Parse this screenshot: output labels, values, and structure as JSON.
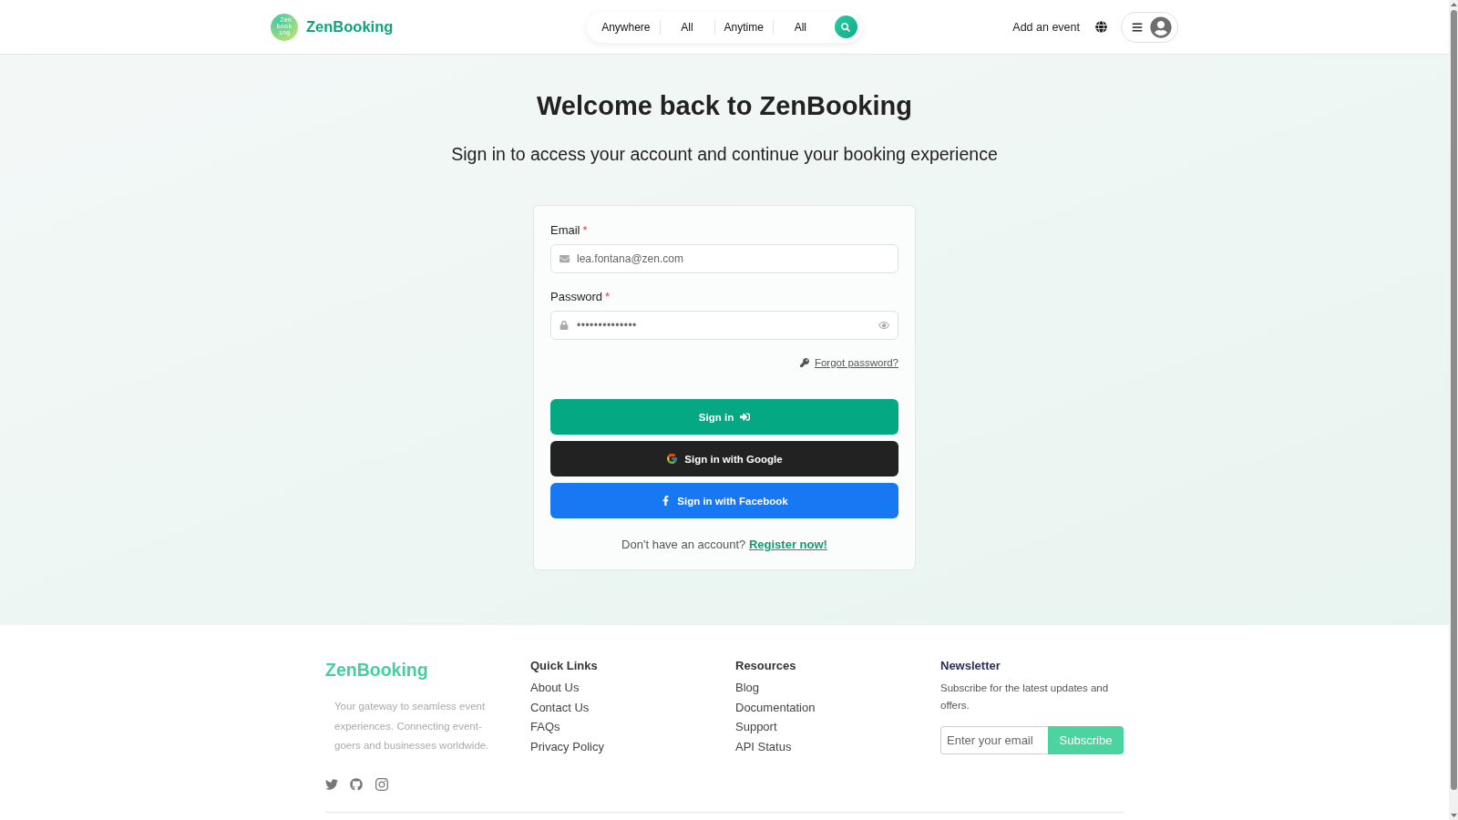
{
  "header": {
    "logo_text": [
      "Zen",
      "book",
      "ing"
    ],
    "brand": "ZenBooking",
    "search_bar": {
      "segments": [
        {
          "label": "Anywhere"
        },
        {
          "label": "All"
        },
        {
          "label": "Anytime"
        },
        {
          "label": "All"
        }
      ]
    },
    "add_event": "Add an event"
  },
  "hero": {
    "title": "Welcome back to ZenBooking",
    "subtitle": "Sign in to access your account and continue your booking experience"
  },
  "form": {
    "fields": [
      {
        "kind": "email",
        "label": "Email",
        "required_mark": "*",
        "value": "lea.fontana@zen.com"
      },
      {
        "kind": "password",
        "label": "Password",
        "required_mark": "*",
        "value": "••••••••••••••"
      }
    ],
    "forgot_link": "Forgot password?",
    "buttons": [
      {
        "kind": "primary",
        "label": "Sign in"
      },
      {
        "kind": "google",
        "label": "Sign in with Google"
      },
      {
        "kind": "facebook",
        "label": "Sign in with Facebook"
      }
    ],
    "register": {
      "text": "Don't have an account?",
      "link": "Register now!"
    }
  },
  "footer": {
    "brand": "ZenBooking",
    "tagline": "Your gateway to seamless event experiences. Connecting event-goers and businesses worldwide.",
    "columns": [
      {
        "title": "Quick Links",
        "links": [
          "About Us",
          "Contact Us",
          "FAQs",
          "Privacy Policy"
        ]
      },
      {
        "title": "Resources",
        "links": [
          "Blog",
          "Documentation",
          "Support",
          "API Status"
        ]
      }
    ],
    "newsletter": {
      "title": "Newsletter",
      "text": "Subscribe for the latest updates and offers.",
      "placeholder": "Enter your email",
      "button": "Subscribe"
    }
  }
}
